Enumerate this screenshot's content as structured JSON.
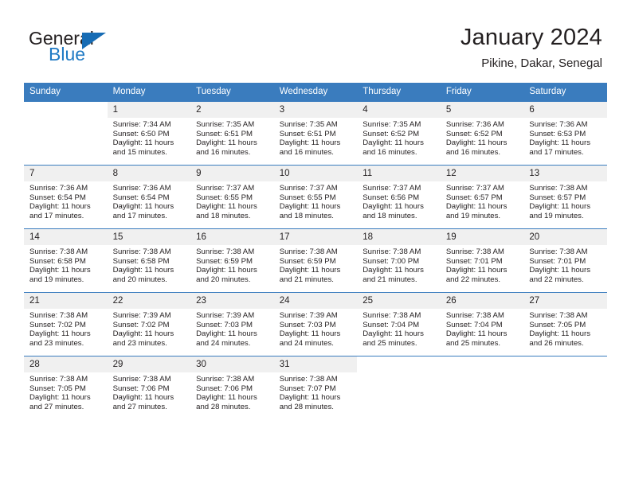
{
  "brand": {
    "name_top": "General",
    "name_bottom": "Blue",
    "logo_icon": "triangle-logo-icon",
    "accent_color": "#1f7ac4"
  },
  "header": {
    "title": "January 2024",
    "subtitle": "Pikine, Dakar, Senegal"
  },
  "calendar": {
    "header_color": "#3a7cbe",
    "daynum_band_color": "#f0f0f0",
    "weekday_headers": [
      "Sunday",
      "Monday",
      "Tuesday",
      "Wednesday",
      "Thursday",
      "Friday",
      "Saturday"
    ],
    "weeks": [
      [
        {
          "date": "",
          "sunrise": "",
          "sunset": "",
          "daylight_line1": "",
          "daylight_line2": ""
        },
        {
          "date": "1",
          "sunrise": "Sunrise: 7:34 AM",
          "sunset": "Sunset: 6:50 PM",
          "daylight_line1": "Daylight: 11 hours",
          "daylight_line2": "and 15 minutes."
        },
        {
          "date": "2",
          "sunrise": "Sunrise: 7:35 AM",
          "sunset": "Sunset: 6:51 PM",
          "daylight_line1": "Daylight: 11 hours",
          "daylight_line2": "and 16 minutes."
        },
        {
          "date": "3",
          "sunrise": "Sunrise: 7:35 AM",
          "sunset": "Sunset: 6:51 PM",
          "daylight_line1": "Daylight: 11 hours",
          "daylight_line2": "and 16 minutes."
        },
        {
          "date": "4",
          "sunrise": "Sunrise: 7:35 AM",
          "sunset": "Sunset: 6:52 PM",
          "daylight_line1": "Daylight: 11 hours",
          "daylight_line2": "and 16 minutes."
        },
        {
          "date": "5",
          "sunrise": "Sunrise: 7:36 AM",
          "sunset": "Sunset: 6:52 PM",
          "daylight_line1": "Daylight: 11 hours",
          "daylight_line2": "and 16 minutes."
        },
        {
          "date": "6",
          "sunrise": "Sunrise: 7:36 AM",
          "sunset": "Sunset: 6:53 PM",
          "daylight_line1": "Daylight: 11 hours",
          "daylight_line2": "and 17 minutes."
        }
      ],
      [
        {
          "date": "7",
          "sunrise": "Sunrise: 7:36 AM",
          "sunset": "Sunset: 6:54 PM",
          "daylight_line1": "Daylight: 11 hours",
          "daylight_line2": "and 17 minutes."
        },
        {
          "date": "8",
          "sunrise": "Sunrise: 7:36 AM",
          "sunset": "Sunset: 6:54 PM",
          "daylight_line1": "Daylight: 11 hours",
          "daylight_line2": "and 17 minutes."
        },
        {
          "date": "9",
          "sunrise": "Sunrise: 7:37 AM",
          "sunset": "Sunset: 6:55 PM",
          "daylight_line1": "Daylight: 11 hours",
          "daylight_line2": "and 18 minutes."
        },
        {
          "date": "10",
          "sunrise": "Sunrise: 7:37 AM",
          "sunset": "Sunset: 6:55 PM",
          "daylight_line1": "Daylight: 11 hours",
          "daylight_line2": "and 18 minutes."
        },
        {
          "date": "11",
          "sunrise": "Sunrise: 7:37 AM",
          "sunset": "Sunset: 6:56 PM",
          "daylight_line1": "Daylight: 11 hours",
          "daylight_line2": "and 18 minutes."
        },
        {
          "date": "12",
          "sunrise": "Sunrise: 7:37 AM",
          "sunset": "Sunset: 6:57 PM",
          "daylight_line1": "Daylight: 11 hours",
          "daylight_line2": "and 19 minutes."
        },
        {
          "date": "13",
          "sunrise": "Sunrise: 7:38 AM",
          "sunset": "Sunset: 6:57 PM",
          "daylight_line1": "Daylight: 11 hours",
          "daylight_line2": "and 19 minutes."
        }
      ],
      [
        {
          "date": "14",
          "sunrise": "Sunrise: 7:38 AM",
          "sunset": "Sunset: 6:58 PM",
          "daylight_line1": "Daylight: 11 hours",
          "daylight_line2": "and 19 minutes."
        },
        {
          "date": "15",
          "sunrise": "Sunrise: 7:38 AM",
          "sunset": "Sunset: 6:58 PM",
          "daylight_line1": "Daylight: 11 hours",
          "daylight_line2": "and 20 minutes."
        },
        {
          "date": "16",
          "sunrise": "Sunrise: 7:38 AM",
          "sunset": "Sunset: 6:59 PM",
          "daylight_line1": "Daylight: 11 hours",
          "daylight_line2": "and 20 minutes."
        },
        {
          "date": "17",
          "sunrise": "Sunrise: 7:38 AM",
          "sunset": "Sunset: 6:59 PM",
          "daylight_line1": "Daylight: 11 hours",
          "daylight_line2": "and 21 minutes."
        },
        {
          "date": "18",
          "sunrise": "Sunrise: 7:38 AM",
          "sunset": "Sunset: 7:00 PM",
          "daylight_line1": "Daylight: 11 hours",
          "daylight_line2": "and 21 minutes."
        },
        {
          "date": "19",
          "sunrise": "Sunrise: 7:38 AM",
          "sunset": "Sunset: 7:01 PM",
          "daylight_line1": "Daylight: 11 hours",
          "daylight_line2": "and 22 minutes."
        },
        {
          "date": "20",
          "sunrise": "Sunrise: 7:38 AM",
          "sunset": "Sunset: 7:01 PM",
          "daylight_line1": "Daylight: 11 hours",
          "daylight_line2": "and 22 minutes."
        }
      ],
      [
        {
          "date": "21",
          "sunrise": "Sunrise: 7:38 AM",
          "sunset": "Sunset: 7:02 PM",
          "daylight_line1": "Daylight: 11 hours",
          "daylight_line2": "and 23 minutes."
        },
        {
          "date": "22",
          "sunrise": "Sunrise: 7:39 AM",
          "sunset": "Sunset: 7:02 PM",
          "daylight_line1": "Daylight: 11 hours",
          "daylight_line2": "and 23 minutes."
        },
        {
          "date": "23",
          "sunrise": "Sunrise: 7:39 AM",
          "sunset": "Sunset: 7:03 PM",
          "daylight_line1": "Daylight: 11 hours",
          "daylight_line2": "and 24 minutes."
        },
        {
          "date": "24",
          "sunrise": "Sunrise: 7:39 AM",
          "sunset": "Sunset: 7:03 PM",
          "daylight_line1": "Daylight: 11 hours",
          "daylight_line2": "and 24 minutes."
        },
        {
          "date": "25",
          "sunrise": "Sunrise: 7:38 AM",
          "sunset": "Sunset: 7:04 PM",
          "daylight_line1": "Daylight: 11 hours",
          "daylight_line2": "and 25 minutes."
        },
        {
          "date": "26",
          "sunrise": "Sunrise: 7:38 AM",
          "sunset": "Sunset: 7:04 PM",
          "daylight_line1": "Daylight: 11 hours",
          "daylight_line2": "and 25 minutes."
        },
        {
          "date": "27",
          "sunrise": "Sunrise: 7:38 AM",
          "sunset": "Sunset: 7:05 PM",
          "daylight_line1": "Daylight: 11 hours",
          "daylight_line2": "and 26 minutes."
        }
      ],
      [
        {
          "date": "28",
          "sunrise": "Sunrise: 7:38 AM",
          "sunset": "Sunset: 7:05 PM",
          "daylight_line1": "Daylight: 11 hours",
          "daylight_line2": "and 27 minutes."
        },
        {
          "date": "29",
          "sunrise": "Sunrise: 7:38 AM",
          "sunset": "Sunset: 7:06 PM",
          "daylight_line1": "Daylight: 11 hours",
          "daylight_line2": "and 27 minutes."
        },
        {
          "date": "30",
          "sunrise": "Sunrise: 7:38 AM",
          "sunset": "Sunset: 7:06 PM",
          "daylight_line1": "Daylight: 11 hours",
          "daylight_line2": "and 28 minutes."
        },
        {
          "date": "31",
          "sunrise": "Sunrise: 7:38 AM",
          "sunset": "Sunset: 7:07 PM",
          "daylight_line1": "Daylight: 11 hours",
          "daylight_line2": "and 28 minutes."
        },
        {
          "date": "",
          "sunrise": "",
          "sunset": "",
          "daylight_line1": "",
          "daylight_line2": ""
        },
        {
          "date": "",
          "sunrise": "",
          "sunset": "",
          "daylight_line1": "",
          "daylight_line2": ""
        },
        {
          "date": "",
          "sunrise": "",
          "sunset": "",
          "daylight_line1": "",
          "daylight_line2": ""
        }
      ]
    ]
  }
}
